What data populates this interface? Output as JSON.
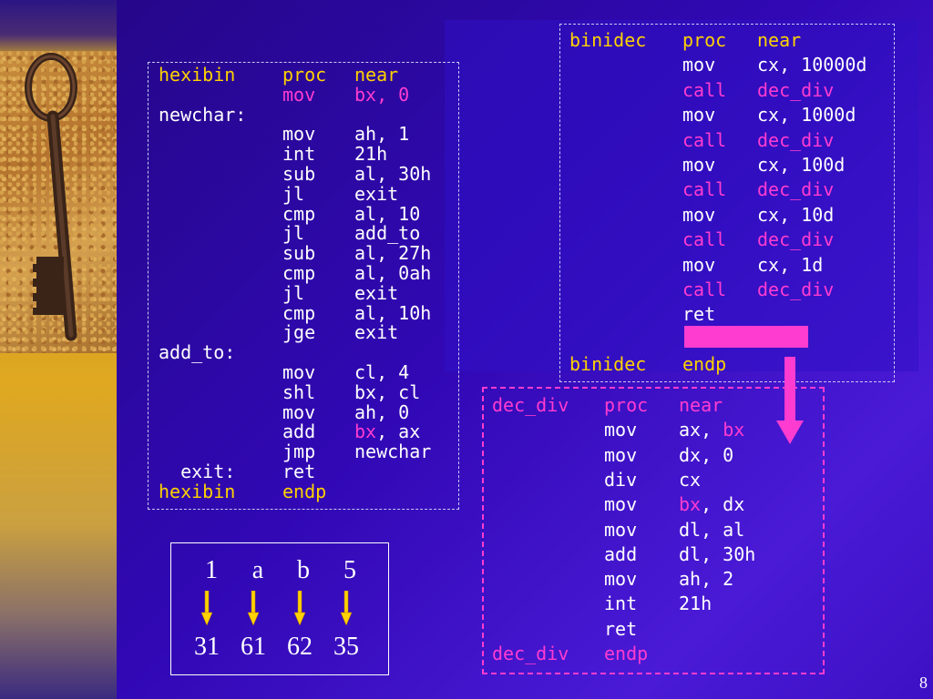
{
  "hexibin": {
    "lines": [
      {
        "c1": "hexibin",
        "c1_color": "yel",
        "c2": "proc",
        "c2_color": "yel",
        "c3": "near",
        "c3_color": "yel"
      },
      {
        "c1": "",
        "c2": "mov",
        "c2_color": "mag",
        "c3": "bx, 0",
        "c3_color": "mag"
      },
      {
        "c1": "newchar:",
        "c1_color": "wht",
        "c2": "",
        "c3": ""
      },
      {
        "c1": "",
        "c2": "mov",
        "c2_color": "wht",
        "c3": "ah, 1",
        "c3_color": "wht"
      },
      {
        "c1": "",
        "c2": "int",
        "c2_color": "wht",
        "c3": "21h",
        "c3_color": "wht"
      },
      {
        "c1": "",
        "c2": "sub",
        "c2_color": "wht",
        "c3": "al, 30h",
        "c3_color": "wht"
      },
      {
        "c1": "",
        "c2": "jl",
        "c2_color": "wht",
        "c3": "exit",
        "c3_color": "wht"
      },
      {
        "c1": "",
        "c2": "cmp",
        "c2_color": "wht",
        "c3": "al, 10",
        "c3_color": "wht"
      },
      {
        "c1": "",
        "c2": "jl",
        "c2_color": "wht",
        "c3": "add_to",
        "c3_color": "wht"
      },
      {
        "c1": "",
        "c2": "sub",
        "c2_color": "wht",
        "c3": "al, 27h",
        "c3_color": "wht"
      },
      {
        "c1": "",
        "c2": "cmp",
        "c2_color": "wht",
        "c3": "al, 0ah",
        "c3_color": "wht"
      },
      {
        "c1": "",
        "c2": "jl",
        "c2_color": "wht",
        "c3": "exit",
        "c3_color": "wht"
      },
      {
        "c1": "",
        "c2": "cmp",
        "c2_color": "wht",
        "c3": "al, 10h",
        "c3_color": "wht"
      },
      {
        "c1": "",
        "c2": "jge",
        "c2_color": "wht",
        "c3": "exit",
        "c3_color": "wht"
      },
      {
        "c1": "add_to:",
        "c1_color": "wht",
        "c2": "",
        "c3": ""
      },
      {
        "c1": "",
        "c2": "mov",
        "c2_color": "wht",
        "c3": "cl, 4",
        "c3_color": "wht"
      },
      {
        "c1": "",
        "c2": "shl",
        "c2_color": "wht",
        "c3": "bx, cl",
        "c3_color": "wht"
      },
      {
        "c1": "",
        "c2": "mov",
        "c2_color": "wht",
        "c3": "ah, 0",
        "c3_color": "wht"
      },
      {
        "c1": "",
        "c2": "add",
        "c2_color": "wht",
        "c3a": "bx",
        "c3a_color": "mag",
        "c3b": ", ax",
        "c3b_color": "wht"
      },
      {
        "c1": "",
        "c2": "jmp",
        "c2_color": "wht",
        "c3": "newchar",
        "c3_color": "wht"
      },
      {
        "c1": "  exit:",
        "c1_color": "wht",
        "c2": "ret",
        "c2_color": "wht",
        "c3": ""
      },
      {
        "c1": "hexibin",
        "c1_color": "yel",
        "c2": "endp",
        "c2_color": "yel",
        "c3": ""
      }
    ]
  },
  "binidec": {
    "lines": [
      {
        "c1": "binidec",
        "c1_color": "yel",
        "c2": "proc",
        "c2_color": "yel",
        "c3": "near",
        "c3_color": "yel"
      },
      {
        "c1": "",
        "c2": "mov",
        "c2_color": "wht",
        "c3": "cx, 10000d",
        "c3_color": "wht"
      },
      {
        "c1": "",
        "c2": "call",
        "c2_color": "mag",
        "c3": "dec_div",
        "c3_color": "mag"
      },
      {
        "c1": "",
        "c2": "mov",
        "c2_color": "wht",
        "c3": "cx, 1000d",
        "c3_color": "wht"
      },
      {
        "c1": "",
        "c2": "call",
        "c2_color": "mag",
        "c3": "dec_div",
        "c3_color": "mag"
      },
      {
        "c1": "",
        "c2": "mov",
        "c2_color": "wht",
        "c3": "cx, 100d",
        "c3_color": "wht"
      },
      {
        "c1": "",
        "c2": "call",
        "c2_color": "mag",
        "c3": "dec_div",
        "c3_color": "mag"
      },
      {
        "c1": "",
        "c2": "mov",
        "c2_color": "wht",
        "c3": "cx, 10d",
        "c3_color": "wht"
      },
      {
        "c1": "",
        "c2": "call",
        "c2_color": "mag",
        "c3": "dec_div",
        "c3_color": "mag"
      },
      {
        "c1": "",
        "c2": "mov",
        "c2_color": "wht",
        "c3": "cx, 1d",
        "c3_color": "wht"
      },
      {
        "c1": "",
        "c2": "call",
        "c2_color": "mag",
        "c3": "dec_div",
        "c3_color": "mag"
      },
      {
        "c1": "",
        "c2": "ret",
        "c2_color": "wht",
        "c3": ""
      },
      {
        "c1": "",
        "c2": "",
        "c3": ""
      },
      {
        "c1": "binidec",
        "c1_color": "yel",
        "c2": "endp",
        "c2_color": "yel",
        "c3": ""
      }
    ]
  },
  "dec_div": {
    "lines": [
      {
        "c1": "dec_div",
        "c1_color": "mag",
        "c2": "proc",
        "c2_color": "mag",
        "c3": "near",
        "c3_color": "mag"
      },
      {
        "c1": "",
        "c2": "mov",
        "c2_color": "wht",
        "c3a": "ax, ",
        "c3a_color": "wht",
        "c3b": "bx",
        "c3b_color": "mag"
      },
      {
        "c1": "",
        "c2": "mov",
        "c2_color": "wht",
        "c3": "dx, 0",
        "c3_color": "wht"
      },
      {
        "c1": "",
        "c2": "div",
        "c2_color": "wht",
        "c3": "cx",
        "c3_color": "wht"
      },
      {
        "c1": "",
        "c2": "mov",
        "c2_color": "wht",
        "c3a": "bx",
        "c3a_color": "mag",
        "c3b": ", dx",
        "c3b_color": "wht"
      },
      {
        "c1": "",
        "c2": "mov",
        "c2_color": "wht",
        "c3": "dl, al",
        "c3_color": "wht"
      },
      {
        "c1": "",
        "c2": "add",
        "c2_color": "wht",
        "c3": "dl, 30h",
        "c3_color": "wht"
      },
      {
        "c1": "",
        "c2": "mov",
        "c2_color": "wht",
        "c3": "ah, 2",
        "c3_color": "wht"
      },
      {
        "c1": "",
        "c2": "int",
        "c2_color": "wht",
        "c3": "21h",
        "c3_color": "wht"
      },
      {
        "c1": "",
        "c2": "ret",
        "c2_color": "wht",
        "c3": ""
      },
      {
        "c1": "dec_div",
        "c1_color": "mag",
        "c2": "endp",
        "c2_color": "mag",
        "c3": ""
      }
    ]
  },
  "conversion": {
    "chars": [
      "1",
      "a",
      "b",
      "5"
    ],
    "hex": [
      "31",
      "61",
      "62",
      "35"
    ]
  },
  "page_number": "8",
  "colors": {
    "yellow": "#ffd200",
    "magenta": "#ff3cd0",
    "white": "#ffffff",
    "background": "#2a0a8c"
  }
}
